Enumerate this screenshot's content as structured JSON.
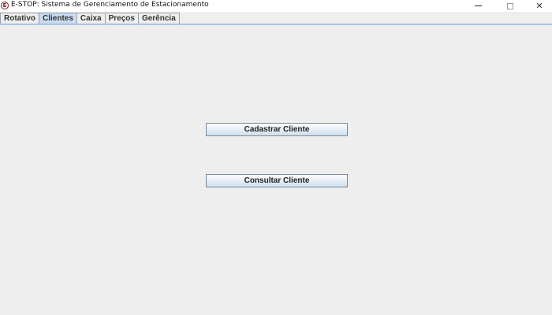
{
  "window": {
    "icon_glyph": "E",
    "title": "E-STOP: Sistema de Gerenciamento de Estacionamento",
    "controls": {
      "minimize": "minimize-icon",
      "maximize": "maximize-icon",
      "close_glyph": "✕"
    }
  },
  "tabs": [
    {
      "label": "Rotativo",
      "active": false
    },
    {
      "label": "Clientes",
      "active": true
    },
    {
      "label": "Caixa",
      "active": false
    },
    {
      "label": "Preços",
      "active": false
    },
    {
      "label": "Gerência",
      "active": false
    }
  ],
  "clientes_panel": {
    "register_button": "Cadastrar Cliente",
    "search_button": "Consultar Cliente"
  },
  "colors": {
    "background": "#eeeeee",
    "active_tab": "#c9dcef",
    "button_border": "#7a8a99"
  }
}
